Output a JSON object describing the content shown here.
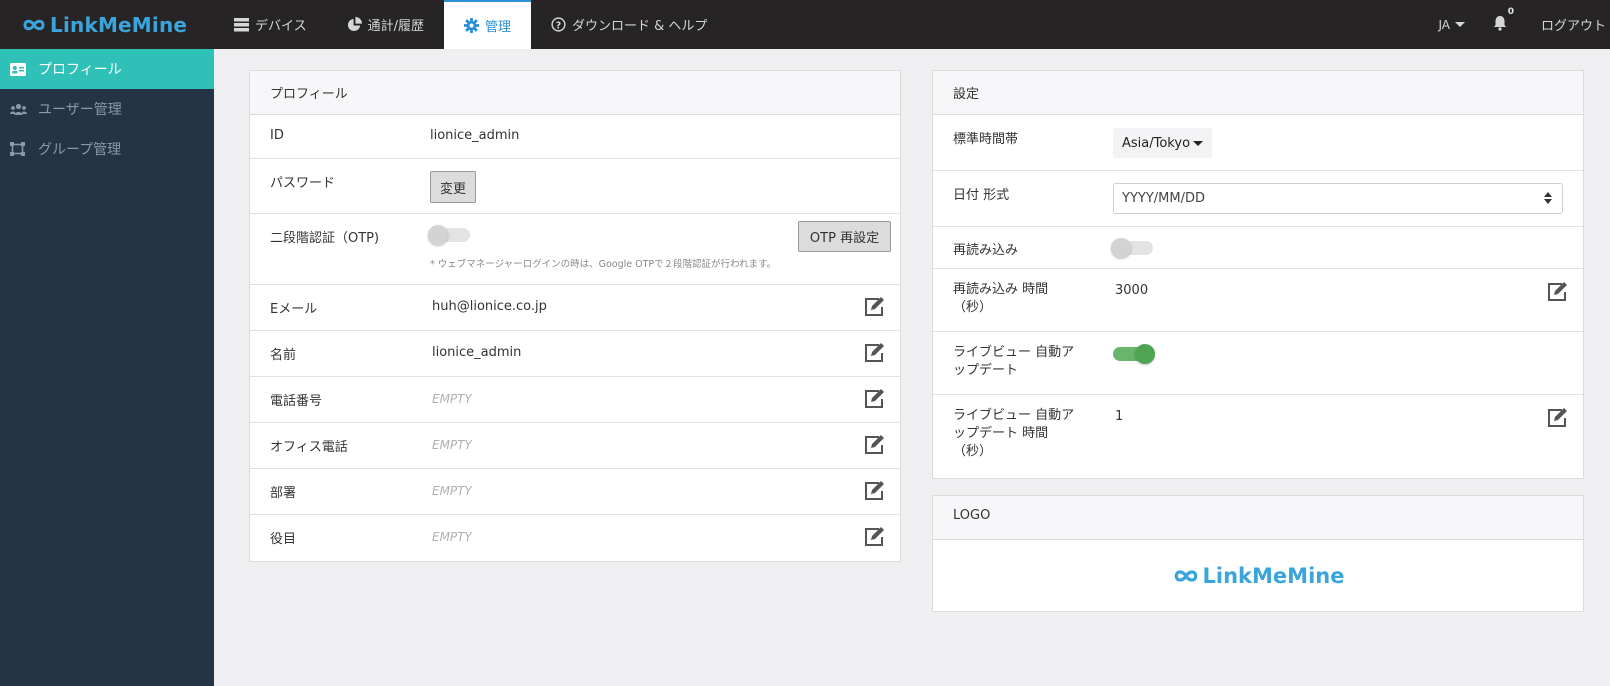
{
  "app": {
    "logo_text": "LinkMeMine",
    "brand_color": "#3aa5dd"
  },
  "nav": {
    "items": [
      {
        "label": "デバイス",
        "icon": "server-icon"
      },
      {
        "label": "通計/履歴",
        "icon": "pie-chart-icon"
      },
      {
        "label": "管理",
        "icon": "gear-icon",
        "active": true
      },
      {
        "label": "ダウンロード & ヘルプ",
        "icon": "question-circle-icon"
      }
    ],
    "lang": "JA",
    "notification_count": "0",
    "logout": "ログアウト"
  },
  "sidebar": {
    "items": [
      {
        "label": "プロフィール",
        "icon": "id-card-icon",
        "active": true
      },
      {
        "label": "ユーザー管理",
        "icon": "users-icon"
      },
      {
        "label": "グループ管理",
        "icon": "group-frame-icon"
      }
    ]
  },
  "profile": {
    "title": "プロフィール",
    "id_label": "ID",
    "id_value": "lionice_admin",
    "password_label": "パスワード",
    "password_button": "変更",
    "otp_label": "二段階認証（OTP)",
    "otp_enabled": false,
    "otp_button": "OTP 再設定",
    "otp_note": "* ウェブマネージャーログインの時は、Google OTPで２段階認証が行われます。",
    "email_label": "Eメール",
    "email_value": "huh@lionice.co.jp",
    "name_label": "名前",
    "name_value": "lionice_admin",
    "phone_label": "電話番号",
    "phone_value": "EMPTY",
    "office_label": "オフィス電話",
    "office_value": "EMPTY",
    "dept_label": "部署",
    "dept_value": "EMPTY",
    "role_label": "役目",
    "role_value": "EMPTY"
  },
  "settings": {
    "title": "設定",
    "tz_label": "標準時間帯",
    "tz_value": "Asia/Tokyo",
    "date_label": "日付 形式",
    "date_value": "YYYY/MM/DD",
    "reload_label": "再読み込み",
    "reload_enabled": false,
    "reload_time_label_1": "再読み込み 時間",
    "reload_time_label_2": "（秒）",
    "reload_time_value": "3000",
    "live_label_1": "ライブビュー 自動ア",
    "live_label_2": "ップデート",
    "live_enabled": true,
    "live_time_label_1": "ライブビュー 自動ア",
    "live_time_label_2": "ップデート 時間",
    "live_time_label_3": "（秒）",
    "live_time_value": "1"
  },
  "logo_panel": {
    "title": "LOGO",
    "logo_text": "LinkMeMine"
  }
}
